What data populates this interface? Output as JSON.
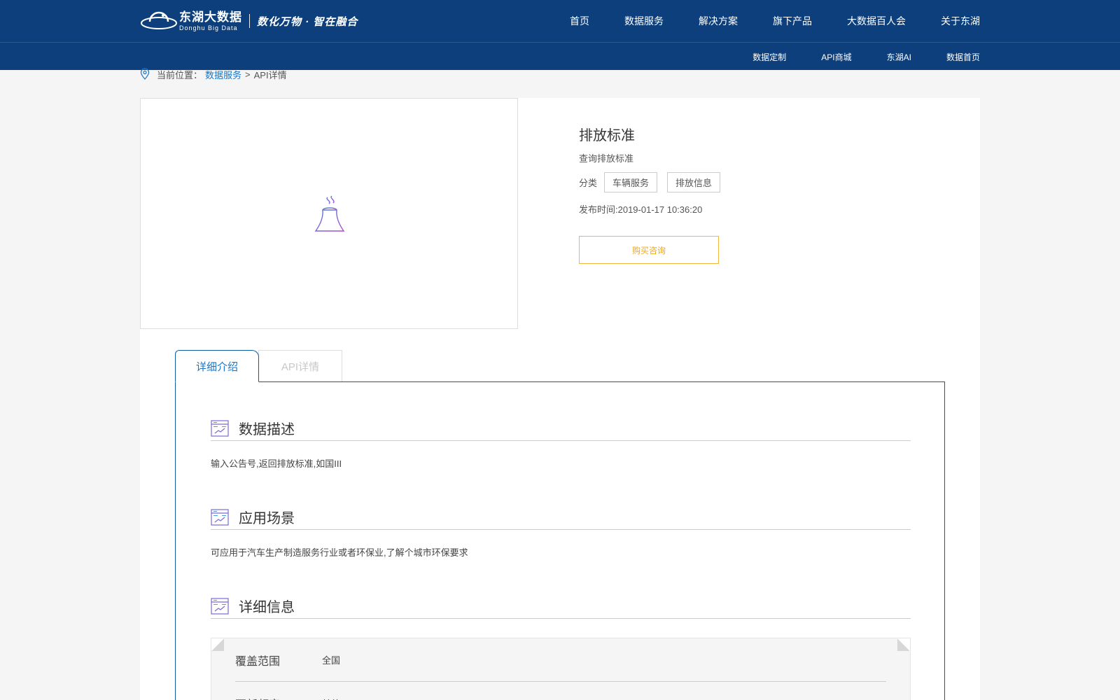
{
  "header": {
    "logo_cn": "东湖大数据",
    "logo_en": "Donghu Big Data",
    "slogan": "数化万物 · 智在融合",
    "nav": [
      "首页",
      "数据服务",
      "解决方案",
      "旗下产品",
      "大数据百人会",
      "关于东湖"
    ],
    "subnav": [
      "数据定制",
      "API商城",
      "东湖AI",
      "数据首页"
    ]
  },
  "breadcrumb": {
    "prefix": "当前位置：",
    "link": "数据服务",
    "separator": ">",
    "current": "API详情"
  },
  "product": {
    "title": "排放标准",
    "description": "查询排放标准",
    "category_label": "分类",
    "tags": [
      "车辆服务",
      "排放信息"
    ],
    "publish_time": "发布时间:2019-01-17 10:36:20",
    "buy_label": "购买咨询",
    "icon": "cooling-tower-icon"
  },
  "tabs": [
    "详细介绍",
    "API详情"
  ],
  "sections": [
    {
      "title": "数据描述",
      "text": "输入公告号,返回排放标准,如国III"
    },
    {
      "title": "应用场景",
      "text": "可应用于汽车生产制造服务行业或者环保业,了解个城市环保要求"
    },
    {
      "title": "详细信息",
      "text": ""
    }
  ],
  "details": [
    {
      "key": "覆盖范围",
      "value": "全国"
    },
    {
      "key": "更新频率",
      "value": "其他"
    }
  ],
  "colors": {
    "header_bg": "#0c3f7c",
    "link_blue": "#1976c6",
    "buy_orange": "#f0a814"
  }
}
